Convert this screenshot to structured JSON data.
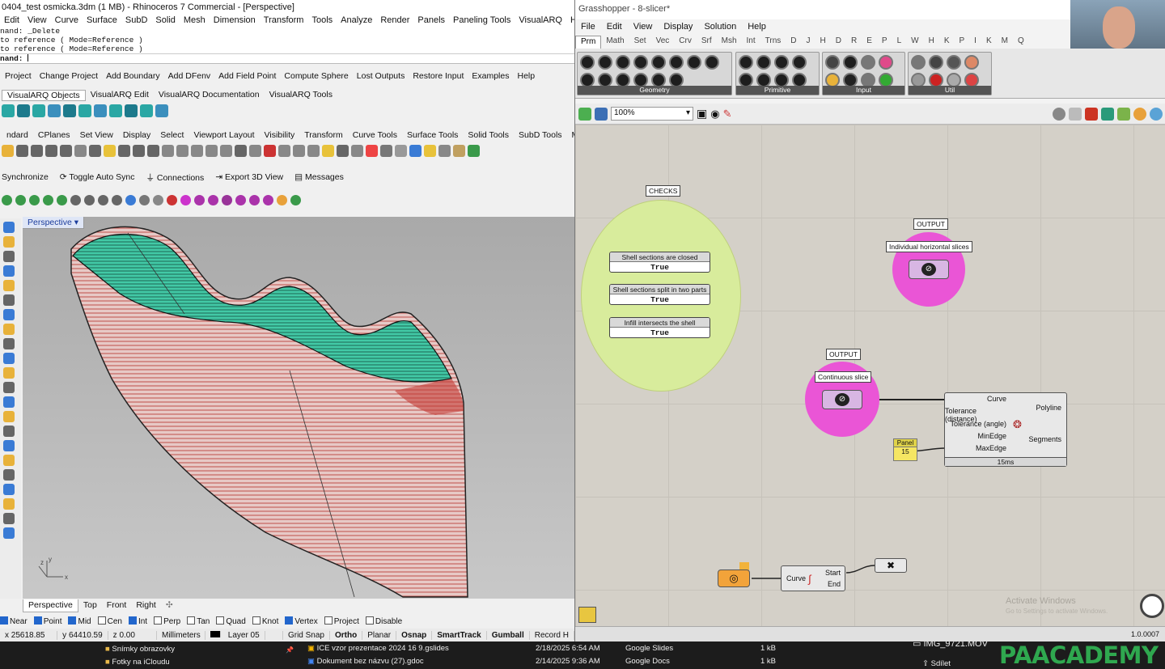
{
  "rhino": {
    "title": "0404_test osmicka.3dm (1 MB) - Rhinoceros 7 Commercial - [Perspective]",
    "menu": [
      "Edit",
      "View",
      "Curve",
      "Surface",
      "SubD",
      "Solid",
      "Mesh",
      "Dimension",
      "Transform",
      "Tools",
      "Analyze",
      "Render",
      "Panels",
      "Paneling Tools",
      "VisualARQ",
      "Help"
    ],
    "command_history": [
      "nand: _Delete",
      "to reference ( Mode=Reference )",
      "to reference ( Mode=Reference )"
    ],
    "command_prompt": "nand:",
    "plugin_toolbar": [
      "Project",
      "Change Project",
      "Add Boundary",
      "Add DFenv",
      "Add Field Point",
      "Compute Sphere",
      "Lost Outputs",
      "Restore Input",
      "Examples",
      "Help"
    ],
    "visualarq_tabs": [
      "VisualARQ Objects",
      "VisualARQ Edit",
      "VisualARQ Documentation",
      "VisualARQ Tools"
    ],
    "toolbar_tabs": [
      "ndard",
      "CPlanes",
      "Set View",
      "Display",
      "Select",
      "Viewport Layout",
      "Visibility",
      "Transform",
      "Curve Tools",
      "Surface Tools",
      "Solid Tools",
      "SubD Tools",
      "Mesh Tools"
    ],
    "sync_bar": {
      "synchronize": "Synchronize",
      "toggle": "Toggle Auto Sync",
      "connections": "Connections",
      "export": "Export 3D View",
      "messages": "Messages"
    },
    "viewport_label": "Perspective",
    "viewport_tabs": [
      "Perspective",
      "Top",
      "Front",
      "Right"
    ],
    "osnap": [
      {
        "label": "Near",
        "checked": true
      },
      {
        "label": "Point",
        "checked": true
      },
      {
        "label": "Mid",
        "checked": true
      },
      {
        "label": "Cen",
        "checked": false
      },
      {
        "label": "Int",
        "checked": true
      },
      {
        "label": "Perp",
        "checked": false
      },
      {
        "label": "Tan",
        "checked": false
      },
      {
        "label": "Quad",
        "checked": false
      },
      {
        "label": "Knot",
        "checked": false
      },
      {
        "label": "Vertex",
        "checked": true
      },
      {
        "label": "Project",
        "checked": false
      },
      {
        "label": "Disable",
        "checked": false
      }
    ],
    "status": {
      "x": "x 25618.85",
      "y": "y 64410.59",
      "z": "z 0.00",
      "units": "Millimeters",
      "layer": "Layer 05",
      "grid_snap": "Grid Snap",
      "ortho": "Ortho",
      "planar": "Planar",
      "osnap": "Osnap",
      "smarttrack": "SmartTrack",
      "gumball": "Gumball",
      "record": "Record H"
    }
  },
  "grasshopper": {
    "title": "Grasshopper - 8-slicer*",
    "menu": [
      "File",
      "Edit",
      "View",
      "Display",
      "Solution",
      "Help"
    ],
    "tabs": [
      "Prm",
      "Math",
      "Set",
      "Vec",
      "Crv",
      "Srf",
      "Msh",
      "Int",
      "Trns",
      "D",
      "J",
      "H",
      "D",
      "R",
      "E",
      "P",
      "L",
      "W",
      "H",
      "K",
      "P",
      "I",
      "K",
      "M",
      "Q"
    ],
    "ribbon_groups": [
      "Geometry",
      "Primitive",
      "Input",
      "Util"
    ],
    "zoom": "100%",
    "checks_label": "CHECKS",
    "toggles": [
      {
        "title": "Shell sections are closed",
        "value": "True"
      },
      {
        "title": "Shell sections split in two parts",
        "value": "True"
      },
      {
        "title": "Infill intersects the shell",
        "value": "True"
      }
    ],
    "output1": {
      "label": "OUTPUT",
      "name": "Individual horizontal slices"
    },
    "output2": {
      "label": "OUTPUT",
      "name": "Continuous slice"
    },
    "polyline_comp": {
      "inputs": [
        "Curve",
        "Tolerance (distance)",
        "Tolerance (angle)",
        "MinEdge",
        "MaxEdge"
      ],
      "outputs": [
        "Polyline",
        "Segments"
      ],
      "time": "15ms"
    },
    "panel": {
      "title": "Panel",
      "value": "15"
    },
    "endpoints_comp": {
      "input": "Curve",
      "outputs": [
        "Start",
        "End"
      ]
    },
    "watermark": {
      "line1": "Activate Windows",
      "line2": "Go to Settings to activate Windows."
    },
    "version": "1.0.0007"
  },
  "taskbar": {
    "folders": [
      "Snímky obrazovky",
      "Fotky na iCloudu"
    ],
    "files": [
      {
        "name": "ICE vzor prezentace 2024 16 9.gslides",
        "date": "2/18/2025 6:54 AM",
        "type": "Google Slides",
        "size": "1 kB"
      },
      {
        "name": "Dokument bez názvu (27).gdoc",
        "date": "2/14/2025 9:36 AM",
        "type": "Google Docs",
        "size": "1 kB"
      }
    ],
    "video_file": "IMG_9721.MOV",
    "share": "Sdílet",
    "brand": "PAACADEMY"
  }
}
